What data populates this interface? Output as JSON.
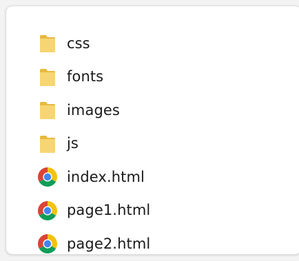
{
  "file_list": {
    "items": [
      {
        "name": "css",
        "type": "folder",
        "icon": "folder-icon"
      },
      {
        "name": "fonts",
        "type": "folder",
        "icon": "folder-icon"
      },
      {
        "name": "images",
        "type": "folder",
        "icon": "folder-icon"
      },
      {
        "name": "js",
        "type": "folder",
        "icon": "folder-icon"
      },
      {
        "name": "index.html",
        "type": "html",
        "icon": "chrome-icon"
      },
      {
        "name": "page1.html",
        "type": "html",
        "icon": "chrome-icon"
      },
      {
        "name": "page2.html",
        "type": "html",
        "icon": "chrome-icon"
      }
    ]
  },
  "colors": {
    "folder_front": "#f7d572",
    "folder_back": "#e7b93f",
    "chrome_red": "#db4437",
    "chrome_yellow": "#f4c20d",
    "chrome_green": "#0f9d58",
    "chrome_blue": "#4285f4"
  }
}
